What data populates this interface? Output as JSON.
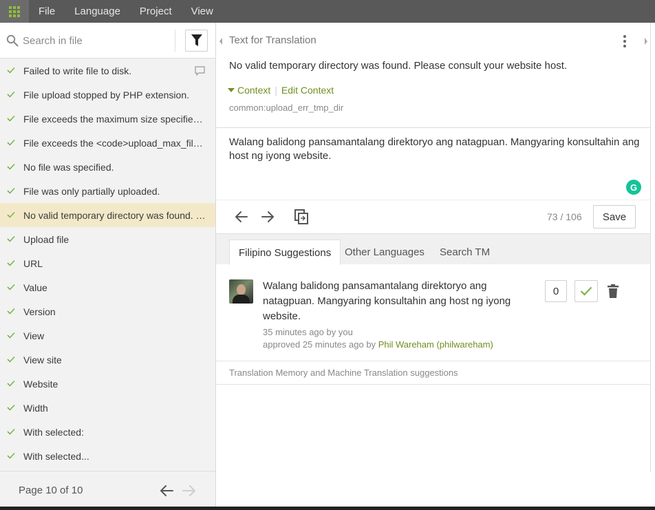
{
  "menubar": {
    "apps_icon": "grid-icon",
    "items": [
      "File",
      "Language",
      "Project",
      "View"
    ]
  },
  "sidebar": {
    "search": {
      "placeholder": "Search in file"
    },
    "strings": [
      {
        "label": "Failed to write file to disk.",
        "has_comment": true
      },
      {
        "label": "File upload stopped by PHP extension."
      },
      {
        "label": "File exceeds the maximum size specified i..."
      },
      {
        "label": "File exceeds the <code>upload_max_filesi..."
      },
      {
        "label": "No file was specified."
      },
      {
        "label": "File was only partially uploaded."
      },
      {
        "label": "No valid temporary directory was found. P...",
        "active": true
      },
      {
        "label": "Upload file"
      },
      {
        "label": "URL"
      },
      {
        "label": "Value"
      },
      {
        "label": "Version"
      },
      {
        "label": "View"
      },
      {
        "label": "View site"
      },
      {
        "label": "Website"
      },
      {
        "label": "Width"
      },
      {
        "label": "With selected:"
      },
      {
        "label": "With selected..."
      }
    ],
    "pager": {
      "label": "Page 10 of 10"
    }
  },
  "editor": {
    "header_title": "Text for Translation",
    "source_text": "No valid temporary directory was found. Please consult your website host.",
    "context_label": "Context",
    "edit_context_label": "Edit Context",
    "context_key": "common:upload_err_tmp_dir",
    "translation_text": "Walang balidong pansamantalang direktoryo ang natagpuan. Mangyaring konsultahin ang host ng iyong website.",
    "grammarly_letter": "G",
    "counter": "73 / 106",
    "save_label": "Save"
  },
  "tabs": [
    {
      "label": "Filipino Suggestions",
      "active": true
    },
    {
      "label": "Other Languages"
    },
    {
      "label": "Search TM"
    }
  ],
  "suggestion": {
    "text": "Walang balidong pansamantalang direktoryo ang natagpuan. Mangyaring konsultahin ang host ng iyong website.",
    "meta_submitted": "35 minutes ago by you",
    "meta_approved_prefix": "approved 25 minutes ago by",
    "approver": "Phil Wareham (philwareham)",
    "votes": "0"
  },
  "tm_header": "Translation Memory and Machine Translation suggestions",
  "colors": {
    "accent_green": "#6e8f1e",
    "active_row": "#f3e9c9",
    "menubar": "#595959"
  }
}
